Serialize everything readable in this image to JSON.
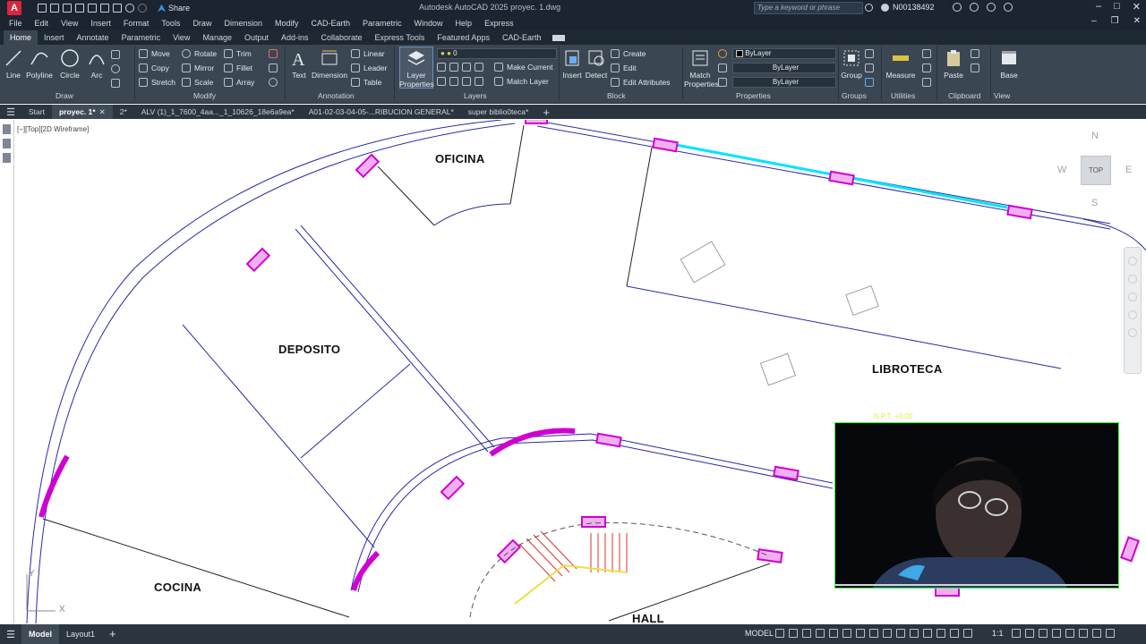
{
  "app": {
    "title": "Autodesk AutoCAD 2025    proyec. 1.dwg",
    "logo_letter": "A",
    "share_label": "Share",
    "search_placeholder": "Type a keyword or phrase",
    "user": "N00138492"
  },
  "menu": [
    "File",
    "Edit",
    "View",
    "Insert",
    "Format",
    "Tools",
    "Draw",
    "Dimension",
    "Modify",
    "CAD-Earth",
    "Parametric",
    "Window",
    "Help",
    "Express"
  ],
  "ribbon_tabs": [
    "Home",
    "Insert",
    "Annotate",
    "Parametric",
    "View",
    "Manage",
    "Output",
    "Add-ins",
    "Collaborate",
    "Express Tools",
    "Featured Apps",
    "CAD-Earth"
  ],
  "ribbon": {
    "draw": {
      "line": "Line",
      "polyline": "Polyline",
      "circle": "Circle",
      "arc": "Arc",
      "panel": "Draw"
    },
    "modify": {
      "move": "Move",
      "rotate": "Rotate",
      "trim": "Trim",
      "copy": "Copy",
      "mirror": "Mirror",
      "fillet": "Fillet",
      "stretch": "Stretch",
      "scale": "Scale",
      "array": "Array",
      "panel": "Modify"
    },
    "annotation": {
      "text": "Text",
      "dimension": "Dimension",
      "linear": "Linear",
      "leader": "Leader",
      "table": "Table",
      "panel": "Annotation"
    },
    "layers": {
      "layer_properties": "Layer Properties",
      "layer_value": "0",
      "make_current": "Make Current",
      "match_layer": "Match Layer",
      "panel": "Layers"
    },
    "block": {
      "insert": "Insert",
      "detect": "Detect",
      "create": "Create",
      "edit": "Edit",
      "edit_attributes": "Edit Attributes",
      "panel": "Block"
    },
    "properties": {
      "match_properties": "Match Properties",
      "bylayer_color": "ByLayer",
      "bylayer_linetype": "ByLayer",
      "bylayer_lineweight": "ByLayer",
      "panel": "Properties"
    },
    "groups": {
      "group": "Group",
      "panel": "Groups"
    },
    "utilities": {
      "measure": "Measure",
      "panel": "Utilities"
    },
    "clipboard": {
      "paste": "Paste",
      "panel": "Clipboard"
    },
    "view": {
      "base": "Base",
      "panel": "View"
    }
  },
  "doc_tabs": [
    "Start",
    "proyec. 1*",
    "2*",
    "ALV (1)_1_7600_4aa..._1_10626_18e6a9ea*",
    "A01-02-03-04-05-...RIBUCION GENERAL*",
    "super biblio0teca*"
  ],
  "viewport_label": "[−][Top][2D Wireframe]",
  "viewcube": {
    "n": "N",
    "s": "S",
    "w": "W",
    "e": "E",
    "top": "TOP"
  },
  "rooms": {
    "oficina": "OFICINA",
    "deposito": "DEPOSITO",
    "libroteca": "LIBROTECA",
    "cocina": "COCINA",
    "hall": "HALL"
  },
  "libroteca_npt": "N.P.T. +0.00",
  "status": {
    "tabs": [
      "Model",
      "Layout1"
    ],
    "model_label": "MODEL",
    "scale": "1:1"
  }
}
